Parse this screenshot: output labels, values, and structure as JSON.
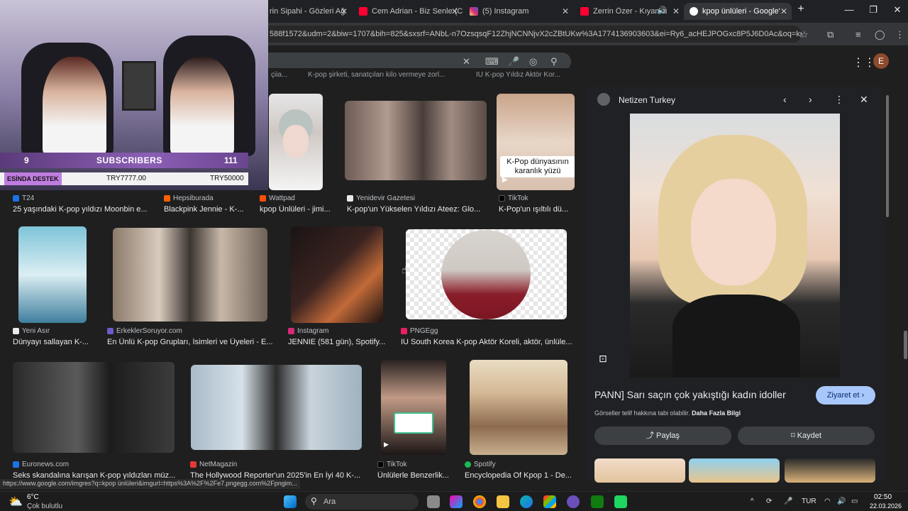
{
  "tabs": [
    {
      "title": "rin Sipahi - Gözleri Ağ",
      "fav": "#ff0033"
    },
    {
      "title": "Cem Adrian - Biz Senle (C",
      "fav": "#ff0033"
    },
    {
      "title": "(5) Instagram",
      "fav": "#d62976"
    },
    {
      "title": "Zerrin Özer - Kıyamar",
      "fav": "#ff0033"
    },
    {
      "title": "kpop ünlüleri - Google'da",
      "fav": "#ffffff"
    }
  ],
  "url": "588f1572&udm=2&biw=1707&bih=825&sxsrf=ANbL-n7OzsqsqF12ZhjNCNNjvX2cZBtUKw%3A1774136903603&ei=Ry6_acHEJPOGxc8P5J6D0Ac&oq=kpop+...",
  "header": {
    "avatar_letter": "E"
  },
  "results": {
    "top_captions": [
      "çiia...",
      "K-pop şirketi, sanatçıları kilo vermeye zorl...",
      "IU K-pop Yıldız Aktör Kor..."
    ],
    "row1": [
      {
        "source": "T24",
        "caption": "25 yaşındaki K-pop yıldızı Moonbin e..."
      },
      {
        "source": "Hepsiburada",
        "caption": "Blackpink Jennie - K-..."
      },
      {
        "source": "Wattpad",
        "caption": "kpop Ünlüleri - jimi..."
      },
      {
        "source": "Yenidevir Gazetesi",
        "caption": "K-pop'un Yükselen Yıldızı Ateez: Glo..."
      },
      {
        "source": "TikTok",
        "caption": "K-Pop'un ışıltılı dü...",
        "overlay": "K-Pop dünyasının karanlık yüzü"
      }
    ],
    "row2": [
      {
        "source": "Yeni Asır",
        "caption": "Dünyayı sallayan K-..."
      },
      {
        "source": "ErkeklerSoruyor.com",
        "caption": "En Ünlü K-pop Grupları, İsimleri ve Üyeleri - E..."
      },
      {
        "source": "Instagram",
        "caption": "JENNIE (581 gün), Spotify..."
      },
      {
        "source": "PNGEgg",
        "caption": "IU South Korea K-pop Aktör Koreli, aktör, ünlüle..."
      }
    ],
    "row3": [
      {
        "source": "Euronews.com",
        "caption": "Seks skandalına karışan K-pop yıldızları müz..."
      },
      {
        "source": "NetMagazin",
        "caption": "The Hollywood Reporter'un 2025'in En İyi 40 K-..."
      },
      {
        "source": "TikTok",
        "caption": "Ünlülerle Benzerlik..."
      },
      {
        "source": "Spotify",
        "caption": "Encyclopedia Of Kpop 1 - De..."
      }
    ]
  },
  "panel": {
    "site": "Netizen Turkey",
    "caption": "PANN] Sarı saçın çok yakıştığı kadın idoller",
    "visit": "Ziyaret et",
    "copyright": "Görseller telif hakkına tabi olabilir.",
    "more_info": "Daha Fazla Bilgi",
    "share": "Paylaş",
    "save": "Kaydet"
  },
  "status_url": "https://www.google.com/imgres?q=kpop ünlüleri&imgurl=https%3A%2F%2Fe7.pngegg.com%2Fpngim...",
  "webcam": {
    "subs_left": "9",
    "subs_label": "SUBSCRIBERS",
    "subs_right": "111",
    "donation_label": "ESİNDA DESTEK",
    "donation_1": "TRY7777.00",
    "donation_2": "TRY50000"
  },
  "taskbar": {
    "temp": "6°C",
    "weather": "Çok bulutlu",
    "search": "Ara",
    "lang": "TUR",
    "time": "02:50",
    "date": "22.03.2026"
  }
}
